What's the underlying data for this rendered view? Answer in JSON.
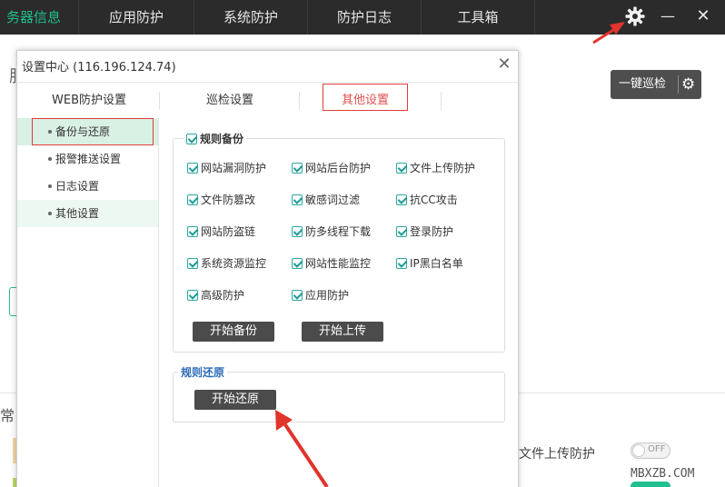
{
  "topbar": {
    "tabs": [
      {
        "label": "务器信息",
        "active": true
      },
      {
        "label": "应用防护",
        "active": false
      },
      {
        "label": "系统防护",
        "active": false
      },
      {
        "label": "防护日志",
        "active": false
      },
      {
        "label": "工具箱",
        "active": false
      }
    ],
    "settings_icon": "gear-icon",
    "minimize_glyph": "—",
    "close_glyph": "✕"
  },
  "background": {
    "left_char": "服",
    "patrol_button": "一键巡检",
    "patrol_gear": "⚙",
    "section_char": "常",
    "upload_label": "文件上传防护",
    "toggle_label": "OFF",
    "watermark": "MBXZB.COM"
  },
  "dialog": {
    "title": "设置中心 (116.196.124.74)",
    "close_glyph": "✕",
    "tabs": [
      {
        "label": "WEB防护设置",
        "active": false
      },
      {
        "label": "巡检设置",
        "active": false
      },
      {
        "label": "其他设置",
        "active": true
      }
    ],
    "sidebar": [
      {
        "label": "备份与还原",
        "selected": true
      },
      {
        "label": "报警推送设置",
        "selected": false
      },
      {
        "label": "日志设置",
        "selected": false
      },
      {
        "label": "其他设置",
        "selected": false
      }
    ],
    "backup_group": {
      "title": "规则备份",
      "checked": true,
      "rules": [
        {
          "label": "网站漏洞防护",
          "checked": true
        },
        {
          "label": "网站后台防护",
          "checked": true
        },
        {
          "label": "文件上传防护",
          "checked": true
        },
        {
          "label": "文件防篡改",
          "checked": true
        },
        {
          "label": "敏感词过滤",
          "checked": true
        },
        {
          "label": "抗CC攻击",
          "checked": true
        },
        {
          "label": "网站防盗链",
          "checked": true
        },
        {
          "label": "防多线程下载",
          "checked": true
        },
        {
          "label": "登录防护",
          "checked": true
        },
        {
          "label": "系统资源监控",
          "checked": true
        },
        {
          "label": "网站性能监控",
          "checked": true
        },
        {
          "label": "IP黑白名单",
          "checked": true
        },
        {
          "label": "高级防护",
          "checked": true
        },
        {
          "label": "应用防护",
          "checked": true
        }
      ],
      "start_backup_button": "开始备份",
      "start_upload_button": "开始上传"
    },
    "restore_group": {
      "title": "规则还原",
      "start_restore_button": "开始还原"
    }
  },
  "colors": {
    "topbar_bg": "#2b2b2b",
    "active_tab": "#1fbf8f",
    "highlight_red": "#e03c3c",
    "group_title_blue": "#2a6bb8",
    "checkbox_teal": "#1b9a93",
    "button_dark": "#4b4b4b"
  }
}
